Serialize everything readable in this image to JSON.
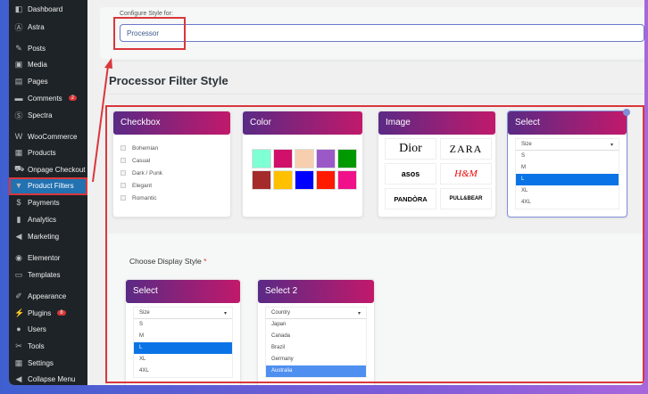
{
  "sidebar": {
    "items": [
      {
        "label": "Dashboard",
        "icon": "dashboard-icon"
      },
      {
        "label": "Astra",
        "icon": "astra-icon"
      },
      {
        "label": "Posts",
        "icon": "pin-icon"
      },
      {
        "label": "Media",
        "icon": "media-icon"
      },
      {
        "label": "Pages",
        "icon": "pages-icon"
      },
      {
        "label": "Comments",
        "icon": "comment-icon",
        "badge": "2"
      },
      {
        "label": "Spectra",
        "icon": "spectra-icon"
      },
      {
        "label": "WooCommerce",
        "icon": "woo-icon"
      },
      {
        "label": "Products",
        "icon": "products-icon"
      },
      {
        "label": "Onpage Checkout",
        "icon": "cart-icon"
      },
      {
        "label": "Product Filters",
        "icon": "filter-icon"
      },
      {
        "label": "Payments",
        "icon": "payments-icon"
      },
      {
        "label": "Analytics",
        "icon": "analytics-icon"
      },
      {
        "label": "Marketing",
        "icon": "megaphone-icon"
      },
      {
        "label": "Elementor",
        "icon": "elementor-icon"
      },
      {
        "label": "Templates",
        "icon": "folder-icon"
      },
      {
        "label": "Appearance",
        "icon": "brush-icon"
      },
      {
        "label": "Plugins",
        "icon": "plug-icon",
        "badge": "8"
      },
      {
        "label": "Users",
        "icon": "user-icon"
      },
      {
        "label": "Tools",
        "icon": "wrench-icon"
      },
      {
        "label": "Settings",
        "icon": "settings-icon"
      },
      {
        "label": "Collapse Menu",
        "icon": "collapse-icon"
      }
    ]
  },
  "config": {
    "label": "Configure Style for:",
    "value": "Processor"
  },
  "title": "Processor Filter Style",
  "styles": {
    "checkbox": {
      "title": "Checkbox",
      "options": [
        "Bohemian",
        "Casual",
        "Dark / Punk",
        "Elegant",
        "Romantic"
      ]
    },
    "color": {
      "title": "Color",
      "swatches": [
        "#7fffd4",
        "#d0106a",
        "#f8cfae",
        "#9b59c8",
        "#009a00",
        "#a52a2a",
        "#ffc000",
        "#0000ff",
        "#ff1a00",
        "#f0108a"
      ]
    },
    "image": {
      "title": "Image",
      "logos": [
        "Dior",
        "ZARA",
        "asos",
        "H&M",
        "PANDÒRA",
        "PULL&BEAR"
      ]
    },
    "select": {
      "title": "Select",
      "placeholder": "Size",
      "options": [
        "S",
        "M",
        "L",
        "XL",
        "4XL"
      ],
      "selected": "L"
    }
  },
  "display": {
    "label": "Choose Display Style",
    "required": "*",
    "select": {
      "title": "Select",
      "placeholder": "Size",
      "options": [
        "S",
        "M",
        "L",
        "XL",
        "4XL"
      ]
    },
    "select2": {
      "title": "Select 2",
      "placeholder": "Country",
      "options": [
        "Japan",
        "Canada",
        "Brazil",
        "Germany",
        "Australia"
      ]
    }
  },
  "colors": {
    "accent_start": "#5a2a85",
    "accent_end": "#c1196b",
    "annotation": "#d9373b",
    "active": "#2271b1"
  }
}
